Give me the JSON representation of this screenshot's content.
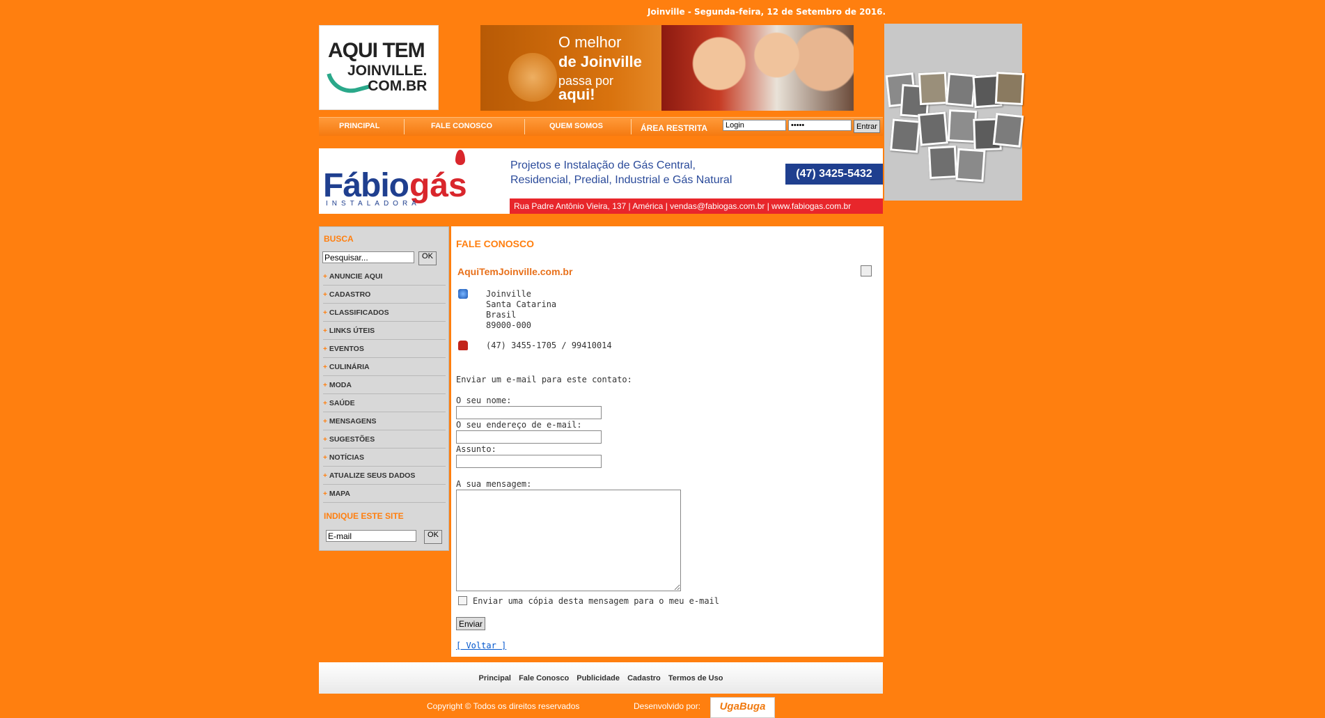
{
  "header": {
    "date_line": "Joinville - Segunda-feira, 12 de Setembro de 2016.",
    "logo": {
      "line1": "AQUI TEM",
      "line2": "JOINVILLE.",
      "line3": "COM.BR"
    },
    "banner": {
      "line1": "O melhor",
      "line2": "de Joinville",
      "line3": "passa por",
      "line4": "aqui!"
    }
  },
  "nav": {
    "items": [
      "PRINCIPAL",
      "FALE CONOSCO",
      "QUEM SOMOS"
    ],
    "area_restrita": "ÁREA RESTRITA",
    "login_value": "Login",
    "password_value": "•••••",
    "enter_label": "Entrar"
  },
  "ad": {
    "brand_fabio": "Fábio",
    "brand_gas": "gás",
    "brand_sub": "INSTALADORA",
    "desc_line1": "Projetos e Instalação de Gás Central,",
    "desc_line2": "Residencial, Predial, Industrial e Gás Natural",
    "phone": "(47) 3425-5432",
    "address": "Rua Padre Antônio Vieira, 137 | América | vendas@fabiogas.com.br | www.fabiogas.com.br"
  },
  "sidebar": {
    "search_title": "BUSCA",
    "search_placeholder": "Pesquisar...",
    "ok_label": "OK",
    "menu": [
      "ANUNCIE AQUI",
      "CADASTRO",
      "CLASSIFICADOS",
      "LINKS ÚTEIS",
      "EVENTOS",
      "CULINÁRIA",
      "MODA",
      "SAÚDE",
      "MENSAGENS",
      "SUGESTÕES",
      "NOTÍCIAS",
      "ATUALIZE SEUS DADOS",
      "MAPA"
    ],
    "indique_title": "INDIQUE ESTE SITE",
    "email_placeholder": "E-mail"
  },
  "contact": {
    "title": "FALE CONOSCO",
    "site_name": "AquiTemJoinville.com.br",
    "address_lines": [
      "Joinville",
      "Santa Catarina",
      "Brasil",
      "89000-000"
    ],
    "phone": "(47) 3455-1705 / 99410014",
    "send_email_label": "Enviar um e-mail para este contato:",
    "name_label": "O seu nome:",
    "email_label": "O seu endereço de e-mail:",
    "subject_label": "Assunto:",
    "message_label": "A sua mensagem:",
    "copy_label": "Enviar uma cópia desta mensagem para o meu e-mail",
    "send_button": "Enviar",
    "back_link": "[ Voltar ]"
  },
  "footer": {
    "links": [
      "Principal",
      "Fale Conosco",
      "Publicidade",
      "Cadastro",
      "Termos de Uso"
    ],
    "copyright": "Copyright © Todos os direitos reservados",
    "developed_by": "Desenvolvido por:",
    "dev_logo": "UgaBuga"
  },
  "colors": {
    "background": "#ff7f0f",
    "accent": "#ff7f0f",
    "brand_blue": "#1f3f8f",
    "brand_red": "#e8262b"
  }
}
